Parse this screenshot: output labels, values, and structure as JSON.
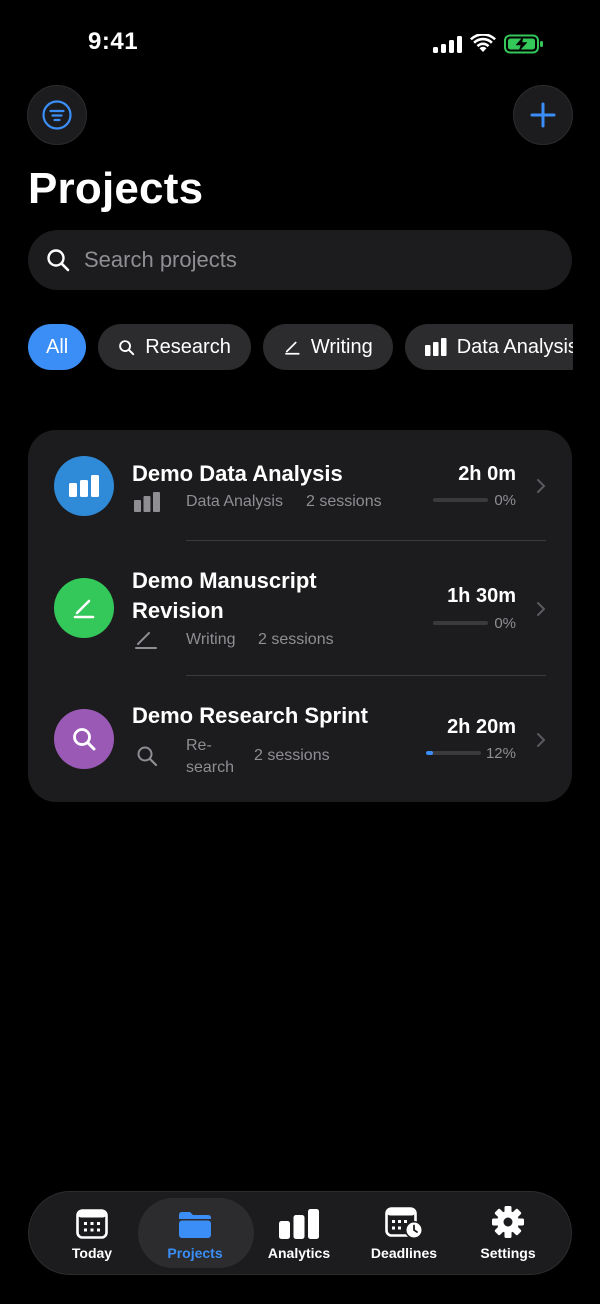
{
  "status_bar": {
    "time": "9:41"
  },
  "header": {
    "title": "Projects"
  },
  "search": {
    "placeholder": "Search projects"
  },
  "filters": [
    {
      "label": "All",
      "icon": "none",
      "active": true
    },
    {
      "label": "Research",
      "icon": "search-icon",
      "active": false
    },
    {
      "label": "Writing",
      "icon": "pencil-icon",
      "active": false
    },
    {
      "label": "Data Analysis",
      "icon": "bar-chart-icon",
      "active": false
    }
  ],
  "projects": [
    {
      "title": "Demo Data Analysis",
      "category": "Data Analysis",
      "sessions": "2 sessions",
      "duration": "2h 0m",
      "progress_label": "0%",
      "progress": 0,
      "color": "#2f8ad8",
      "icon": "bar-chart-icon"
    },
    {
      "title": "Demo Manuscript Revision",
      "category": "Writing",
      "sessions": "2 sessions",
      "duration": "1h 30m",
      "progress_label": "0%",
      "progress": 0,
      "color": "#34c759",
      "icon": "pencil-icon"
    },
    {
      "title": "Demo Research Sprint",
      "category": "Re-\nsearch",
      "sessions": "2 sessions",
      "duration": "2h 20m",
      "progress_label": "12%",
      "progress": 0.12,
      "color": "#9b59b6",
      "icon": "search-icon"
    }
  ],
  "tabs": [
    {
      "label": "Today",
      "icon": "calendar-icon",
      "active": false
    },
    {
      "label": "Projects",
      "icon": "folder-icon",
      "active": true
    },
    {
      "label": "Analytics",
      "icon": "bar-chart-icon",
      "active": false
    },
    {
      "label": "Deadlines",
      "icon": "calendar-clock-icon",
      "active": false
    },
    {
      "label": "Settings",
      "icon": "gear-icon",
      "active": false
    }
  ],
  "colors": {
    "accent": "#3a8ef6",
    "card": "#1c1c1e",
    "muted": "#8e8e93"
  }
}
